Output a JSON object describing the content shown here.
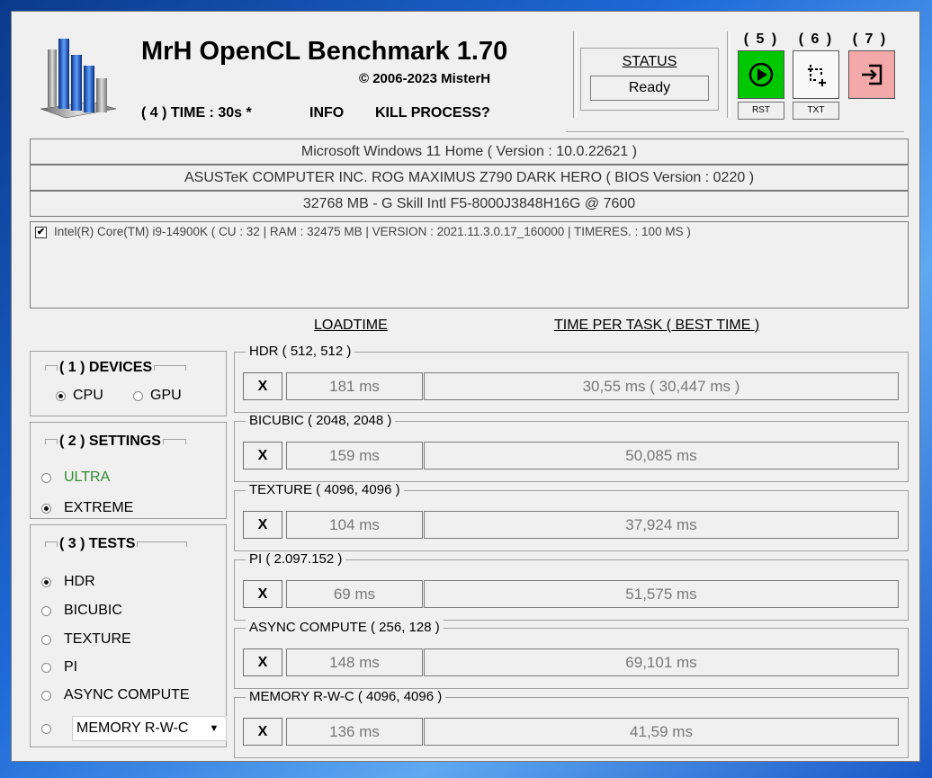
{
  "header": {
    "title": "MrH OpenCL Benchmark 1.70",
    "copyright": "©  2006-2023 MisterH",
    "time_label": "( 4 ) TIME : 30s *",
    "info_label": "INFO",
    "kill_label": "KILL PROCESS?"
  },
  "status": {
    "label": "STATUS",
    "value": "Ready"
  },
  "toolbar": {
    "run": {
      "number": "( 5 )",
      "sub": "RST",
      "icon": "play-icon",
      "color": "#00c800"
    },
    "capture": {
      "number": "( 6 )",
      "sub": "TXT",
      "icon": "screenshot-icon"
    },
    "exit": {
      "number": "( 7 )",
      "icon": "exit-icon",
      "color": "#f4a8a8"
    }
  },
  "system": {
    "os": "Microsoft Windows 11 Home ( Version : 10.0.22621 )",
    "board": "ASUSTeK COMPUTER INC. ROG MAXIMUS Z790 DARK HERO ( BIOS Version : 0220 )",
    "memory": "32768 MB - G Skill Intl F5-8000J3848H16G     @ 7600"
  },
  "device": {
    "checked": true,
    "text": "Intel(R) Core(TM) i9-14900K ( CU : 32 | RAM : 32475 MB | VERSION : 2021.11.3.0.17_160000 | TIMERES. : 100 MS )"
  },
  "columns": {
    "loadtime": "LOADTIME",
    "task": "TIME PER TASK ( BEST TIME )"
  },
  "devices_panel": {
    "title": "( 1 ) DEVICES",
    "options": [
      {
        "label": "CPU",
        "checked": true
      },
      {
        "label": "GPU",
        "checked": false
      }
    ]
  },
  "settings_panel": {
    "title": "( 2 ) SETTINGS",
    "options": [
      {
        "label": "ULTRA",
        "checked": false,
        "color": "#2e8b2e"
      },
      {
        "label": "EXTREME",
        "checked": true
      }
    ]
  },
  "tests_panel": {
    "title": "( 3 ) TESTS",
    "options": [
      {
        "label": "HDR",
        "checked": true
      },
      {
        "label": "BICUBIC",
        "checked": false
      },
      {
        "label": "TEXTURE",
        "checked": false
      },
      {
        "label": "PI",
        "checked": false
      },
      {
        "label": "ASYNC COMPUTE",
        "checked": false
      }
    ],
    "combo": {
      "value": "MEMORY R-W-C"
    }
  },
  "results": [
    {
      "title": "HDR ( 512, 512 )",
      "button": "X",
      "loadtime": "181 ms",
      "task": "30,55 ms ( 30,447 ms )"
    },
    {
      "title": "BICUBIC ( 2048, 2048 )",
      "button": "X",
      "loadtime": "159 ms",
      "task": "50,085 ms"
    },
    {
      "title": "TEXTURE ( 4096, 4096 )",
      "button": "X",
      "loadtime": "104 ms",
      "task": "37,924 ms"
    },
    {
      "title": "PI ( 2.097.152 )",
      "button": "X",
      "loadtime": "69 ms",
      "task": "51,575 ms"
    },
    {
      "title": "ASYNC COMPUTE ( 256, 128 )",
      "button": "X",
      "loadtime": "148 ms",
      "task": "69,101 ms"
    },
    {
      "title": "MEMORY R-W-C ( 4096, 4096 )",
      "button": "X",
      "loadtime": "136 ms",
      "task": "41,59 ms"
    }
  ]
}
